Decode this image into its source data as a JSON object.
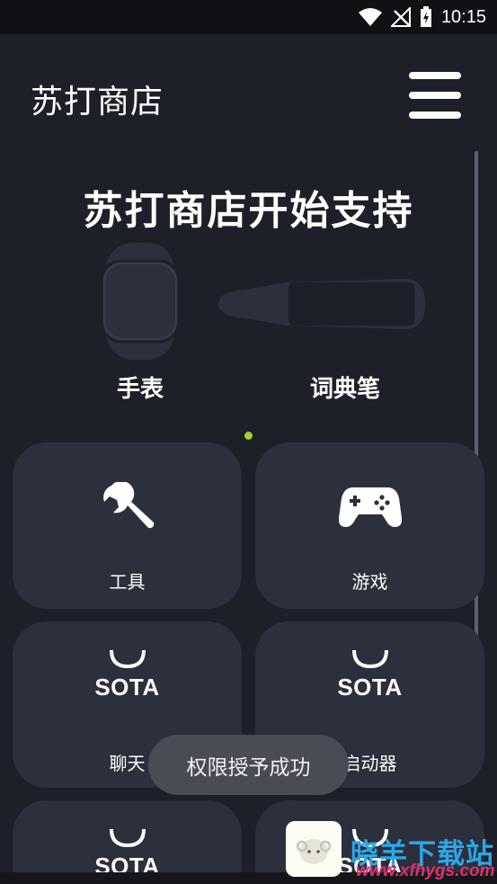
{
  "status_bar": {
    "time": "10:15"
  },
  "header": {
    "title": "苏打商店"
  },
  "banner": {
    "title": "苏打商店开始支持",
    "devices": [
      {
        "label": "手表",
        "icon": "watch-icon"
      },
      {
        "label": "词典笔",
        "icon": "dictionary-pen-icon"
      }
    ]
  },
  "categories": [
    {
      "label": "工具",
      "icon": "wrench-icon"
    },
    {
      "label": "游戏",
      "icon": "gamepad-icon"
    },
    {
      "label": "聊天",
      "brand": "SOTA",
      "icon": "sota-logo-icon"
    },
    {
      "label": "启动器",
      "brand": "SOTA",
      "icon": "sota-logo-icon"
    },
    {
      "brand": "SOTA",
      "icon": "sota-logo-icon"
    },
    {
      "brand": "SOTA",
      "icon": "sota-logo-icon"
    }
  ],
  "toast": {
    "message": "权限授予成功"
  },
  "watermark": {
    "text": "晓羊下载站",
    "url": "www.xfhygs.com"
  },
  "colors": {
    "background": "#1e2029",
    "card": "#2c2f3c",
    "accent_dot": "#a3d12c"
  }
}
